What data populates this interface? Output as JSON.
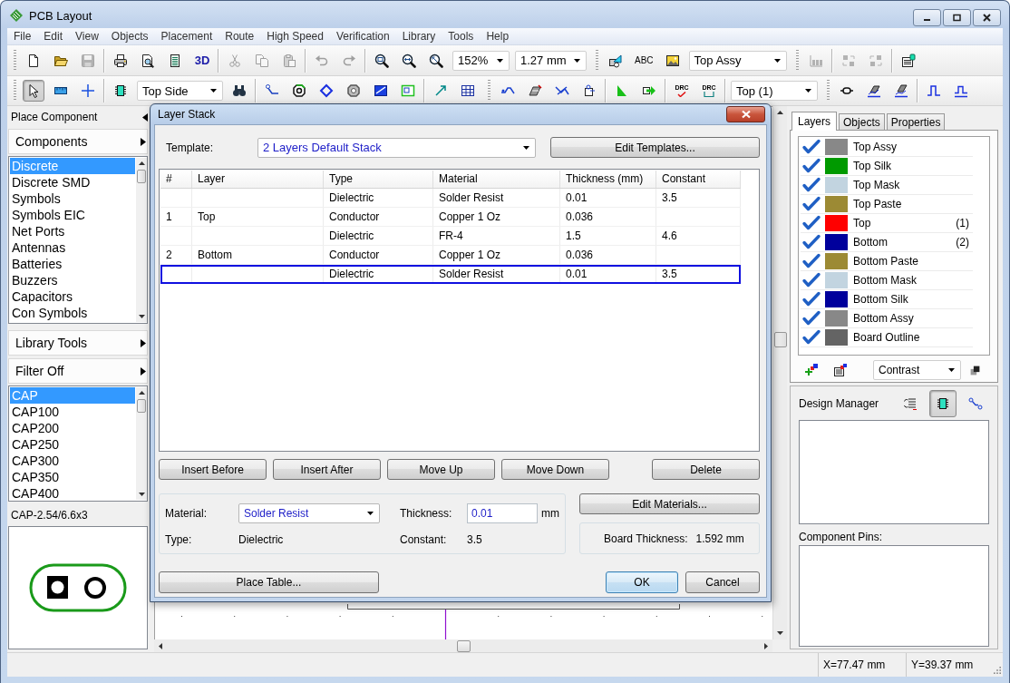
{
  "window": {
    "title": "PCB Layout"
  },
  "menu": [
    "File",
    "Edit",
    "View",
    "Objects",
    "Placement",
    "Route",
    "High Speed",
    "Verification",
    "Library",
    "Tools",
    "Help"
  ],
  "toolbar_1": [
    [
      {
        "kind": "button",
        "disabled": false
      },
      {
        "kind": "button",
        "disabled": false
      },
      {
        "kind": "button",
        "disabled": true
      }
    ],
    [
      {
        "kind": "button",
        "disabled": false
      },
      {
        "kind": "button",
        "disabled": false
      },
      {
        "kind": "button",
        "disabled": false
      },
      {
        "kind": "text",
        "label": "3D",
        "disabled": false
      }
    ],
    [
      {
        "kind": "button",
        "disabled": true
      },
      {
        "kind": "button",
        "disabled": true
      },
      {
        "kind": "button",
        "disabled": true
      }
    ],
    [
      {
        "kind": "button",
        "disabled": true
      },
      {
        "kind": "button",
        "disabled": true
      }
    ],
    [
      {
        "kind": "button",
        "disabled": false
      },
      {
        "kind": "button",
        "disabled": false
      },
      {
        "kind": "button",
        "disabled": false
      },
      {
        "kind": "combo",
        "value": "152%",
        "disabled": false
      },
      {
        "kind": "combo",
        "value": "1.27 mm",
        "disabled": false
      }
    ],
    [
      {
        "kind": "button",
        "disabled": false
      },
      {
        "kind": "text",
        "label": "ABC",
        "disabled": false
      },
      {
        "kind": "button",
        "disabled": false
      },
      {
        "kind": "combo",
        "value": "Top Assy",
        "disabled": false
      }
    ],
    [
      {
        "kind": "button",
        "disabled": true
      }
    ],
    [
      {
        "kind": "button",
        "disabled": true
      },
      {
        "kind": "button",
        "disabled": true
      }
    ],
    [
      {
        "kind": "button",
        "disabled": false
      }
    ]
  ],
  "toolbar_2": [
    [
      {
        "kind": "tool",
        "selected": true,
        "disabled": false
      },
      {
        "kind": "tool",
        "selected": false,
        "disabled": false
      },
      {
        "kind": "tool",
        "selected": false,
        "disabled": false
      }
    ],
    [
      {
        "kind": "button",
        "disabled": false
      },
      {
        "kind": "combo",
        "value": "Top Side",
        "disabled": false
      },
      {
        "kind": "button",
        "disabled": false
      }
    ],
    [
      {
        "kind": "button",
        "disabled": false
      },
      {
        "kind": "button",
        "disabled": false
      },
      {
        "kind": "button",
        "disabled": false
      },
      {
        "kind": "button",
        "disabled": false
      },
      {
        "kind": "button",
        "disabled": false
      },
      {
        "kind": "button",
        "disabled": false
      }
    ],
    [
      {
        "kind": "button",
        "disabled": false
      },
      {
        "kind": "button",
        "disabled": false
      }
    ],
    [
      {
        "kind": "button",
        "disabled": false
      },
      {
        "kind": "button",
        "disabled": false
      },
      {
        "kind": "button",
        "disabled": false
      },
      {
        "kind": "button",
        "disabled": false
      }
    ],
    [
      {
        "kind": "button",
        "disabled": false
      },
      {
        "kind": "button",
        "disabled": false
      }
    ],
    [
      {
        "kind": "text",
        "label": "DRC",
        "disabled": false
      },
      {
        "kind": "text",
        "label": "DRC",
        "disabled": false
      }
    ],
    [
      {
        "kind": "combo",
        "value": "Top (1)",
        "disabled": false
      }
    ],
    [
      {
        "kind": "button",
        "disabled": false
      },
      {
        "kind": "button",
        "disabled": false
      },
      {
        "kind": "button",
        "disabled": false
      }
    ],
    [
      {
        "kind": "button",
        "disabled": false
      },
      {
        "kind": "button",
        "disabled": false
      }
    ]
  ],
  "left_panel": {
    "title": "Place Component",
    "category_menu": "Components",
    "categories": [
      {
        "label": "Discrete",
        "selected": true
      },
      {
        "label": "Discrete SMD",
        "selected": false
      },
      {
        "label": "Symbols",
        "selected": false
      },
      {
        "label": "Symbols EIC",
        "selected": false
      },
      {
        "label": "Net Ports",
        "selected": false
      },
      {
        "label": "Antennas",
        "selected": false
      },
      {
        "label": "Batteries",
        "selected": false
      },
      {
        "label": "Buzzers",
        "selected": false
      },
      {
        "label": "Capacitors",
        "selected": false
      },
      {
        "label": "Con Symbols",
        "selected": false
      }
    ],
    "tools_menu": "Library Tools",
    "filter_menu": "Filter Off",
    "parts": [
      {
        "label": "CAP",
        "selected": true
      },
      {
        "label": "CAP100",
        "selected": false
      },
      {
        "label": "CAP200",
        "selected": false
      },
      {
        "label": "CAP250",
        "selected": false
      },
      {
        "label": "CAP300",
        "selected": false
      },
      {
        "label": "CAP350",
        "selected": false
      },
      {
        "label": "CAP400",
        "selected": false
      }
    ],
    "footprint_name": "CAP-2.54/6.6x3"
  },
  "layers_panel": {
    "tabs": [
      {
        "label": "Layers",
        "selected": true
      },
      {
        "label": "Objects",
        "selected": false
      },
      {
        "label": "Properties",
        "selected": false
      }
    ],
    "layers": [
      {
        "name": "Top Assy",
        "checked": true,
        "color": "#888888"
      },
      {
        "name": "Top Silk",
        "checked": true,
        "color": "#009a00"
      },
      {
        "name": "Top Mask",
        "checked": true,
        "color": "#c2d4e0"
      },
      {
        "name": "Top Paste",
        "checked": true,
        "color": "#9c8a34"
      },
      {
        "name": "Top",
        "checked": true,
        "color": "#ff0000",
        "number": "(1)"
      },
      {
        "name": "Bottom",
        "checked": true,
        "color": "#00009c",
        "number": "(2)"
      },
      {
        "name": "Bottom Paste",
        "checked": true,
        "color": "#9c8a34"
      },
      {
        "name": "Bottom Mask",
        "checked": true,
        "color": "#c2d4e0"
      },
      {
        "name": "Bottom Silk",
        "checked": true,
        "color": "#00009c"
      },
      {
        "name": "Bottom Assy",
        "checked": true,
        "color": "#888888"
      },
      {
        "name": "Board Outline",
        "checked": true,
        "color": "#646464"
      }
    ],
    "scheme": "Contrast"
  },
  "design_manager": {
    "title": "Design Manager",
    "views": [
      {
        "selected": false
      },
      {
        "selected": true
      },
      {
        "selected": false
      }
    ],
    "pins_label": "Component Pins:"
  },
  "status_bar": {
    "x": "X=77.47 mm",
    "y": "Y=39.37 mm"
  },
  "dialog": {
    "title": "Layer Stack",
    "template_label": "Template:",
    "template": "2 Layers Default Stack",
    "edit_templates": "Edit Templates...",
    "table": {
      "columns": [
        "#",
        "Layer",
        "Type",
        "Material",
        "Thickness (mm)",
        "Constant"
      ],
      "rows": [
        {
          "layer_type": "Dielectric",
          "material": "Solder Resist",
          "thickness": "0.01",
          "constant": "3.5",
          "selected": false
        },
        {
          "number": "1",
          "layer": "Top",
          "layer_type": "Conductor",
          "material": "Copper 1 Oz",
          "thickness": "0.036",
          "selected": false
        },
        {
          "layer_type": "Dielectric",
          "material": "FR-4",
          "thickness": "1.5",
          "constant": "4.6",
          "selected": false
        },
        {
          "number": "2",
          "layer": "Bottom",
          "layer_type": "Conductor",
          "material": "Copper 1 Oz",
          "thickness": "0.036",
          "selected": false
        },
        {
          "layer_type": "Dielectric",
          "material": "Solder Resist",
          "thickness": "0.01",
          "constant": "3.5",
          "selected": true
        }
      ]
    },
    "row_buttons": [
      "Insert Before",
      "Insert After",
      "Move Up",
      "Move Down",
      "Delete"
    ],
    "material": {
      "material_label": "Material:",
      "material": "Solder Resist",
      "thickness_label": "Thickness:",
      "thickness": "0.01",
      "unit": "mm",
      "type_label": "Type:",
      "layer_type": "Dielectric",
      "constant_label": "Constant:",
      "constant": "3.5"
    },
    "edit_materials": "Edit Materials...",
    "board_thickness_label": "Board Thickness:",
    "board_thickness": "1.592 mm",
    "place_table": "Place Table...",
    "buttons": [
      {
        "label": "OK",
        "default": true
      },
      {
        "label": "Cancel",
        "default": false
      }
    ]
  }
}
